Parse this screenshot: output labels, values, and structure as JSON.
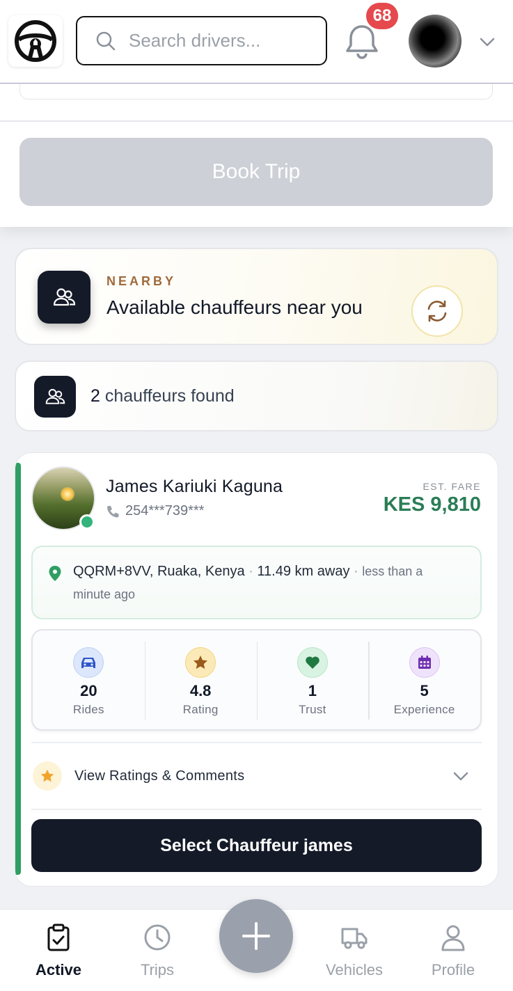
{
  "header": {
    "search_placeholder": "Search drivers...",
    "notification_count": "68"
  },
  "booking": {
    "book_trip_label": "Book Trip"
  },
  "nearby": {
    "kicker": "NEARBY",
    "title": "Available chauffeurs near you"
  },
  "results": {
    "count": "2",
    "label": "chauffeurs found"
  },
  "driver": {
    "name": "James Kariuki Kaguna",
    "phone": "254***739***",
    "fare_label": "EST. FARE",
    "fare_value": "KES 9,810",
    "location": "QQRM+8VV, Ruaka, Kenya",
    "location_sep1": "·",
    "distance": "11.49 km away",
    "location_sep2": "·",
    "last_seen_part1": "less than a",
    "last_seen_part2": "minute ago",
    "stats": [
      {
        "value": "20",
        "label": "Rides"
      },
      {
        "value": "4.8",
        "label": "Rating"
      },
      {
        "value": "1",
        "label": "Trust"
      },
      {
        "value": "5",
        "label": "Experience"
      }
    ],
    "ratings_label": "View Ratings & Comments",
    "select_label": "Select Chauffeur james"
  },
  "nav": {
    "items": [
      {
        "label": "Active"
      },
      {
        "label": "Trips"
      },
      {
        "label": "Vehicles"
      },
      {
        "label": "Profile"
      }
    ]
  },
  "colors": {
    "accent_green": "#2a7d56",
    "dark": "#141a28",
    "badge_red": "#e5484d",
    "kicker_brown": "#a06a3b"
  },
  "icons": {
    "logo": "steering-wheel-icon",
    "search": "search-icon",
    "notifications": "bell-icon",
    "refresh": "refresh-icon",
    "group": "users-icon"
  }
}
